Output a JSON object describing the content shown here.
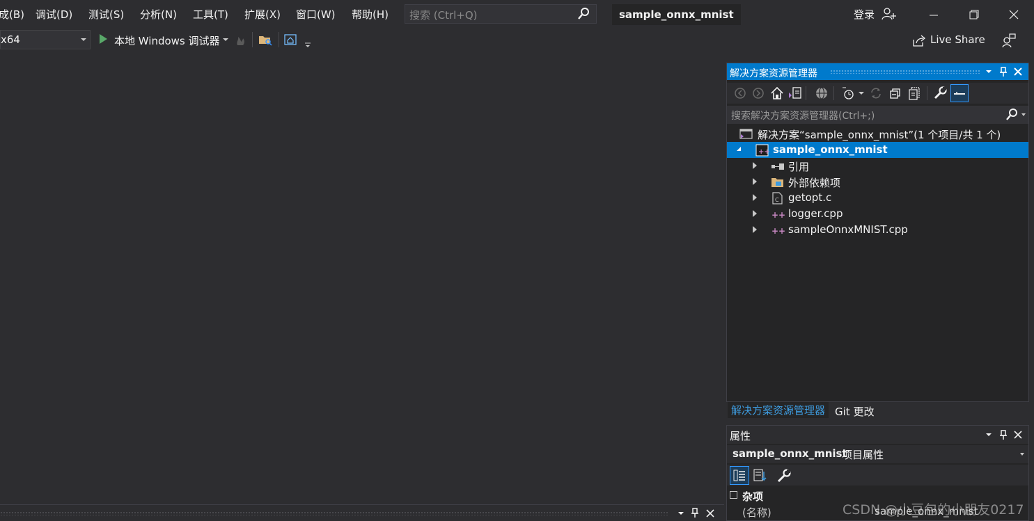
{
  "menu": {
    "items": [
      "成(B)",
      "调试(D)",
      "测试(S)",
      "分析(N)",
      "工具(T)",
      "扩展(X)",
      "窗口(W)",
      "帮助(H)"
    ],
    "search_placeholder": "搜索 (Ctrl+Q)",
    "solution_title": "sample_onnx_mnist",
    "login": "登录"
  },
  "toolbar": {
    "platform": "x64",
    "debugger": "本地 Windows 调试器",
    "live_share": "Live Share"
  },
  "solution_explorer": {
    "title": "解决方案资源管理器",
    "search_placeholder": "搜索解决方案资源管理器(Ctrl+;)",
    "solution_row": "解决方案“sample_onnx_mnist”(1 个项目/共 1 个)",
    "project": "sample_onnx_mnist",
    "children": [
      "引用",
      "外部依赖项",
      "getopt.c",
      "logger.cpp",
      "sampleOnnxMNIST.cpp"
    ]
  },
  "tabs": {
    "explorer": "解决方案资源管理器",
    "git": "Git 更改"
  },
  "properties": {
    "title": "属性",
    "object_name": "sample_onnx_mnist",
    "object_type": "项目属性",
    "category": "杂项",
    "row_label": "(名称)",
    "row_value": "sample_onnx_mnist"
  },
  "watermark": "CSDN @小豆包的小朋友0217",
  "colors": {
    "accent": "#007acc",
    "background": "#2d2d30",
    "panel": "#252526",
    "run_green": "#59a869",
    "cpp_icon": "#c586c0"
  }
}
